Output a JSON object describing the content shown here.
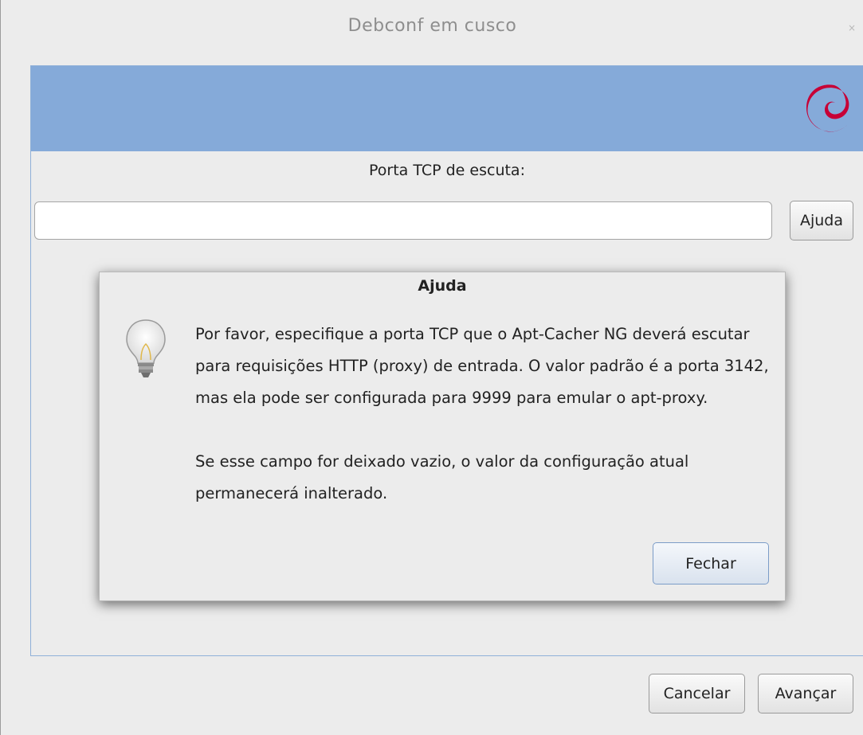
{
  "window": {
    "title": "Debconf em cusco",
    "close_glyph": "×"
  },
  "banner": {
    "logo_icon": "debian-swirl-logo",
    "color": "#85aad9",
    "logo_color": "#c70036"
  },
  "question": {
    "label": "Porta TCP de escuta:",
    "input_value": "",
    "help_label": "Ajuda"
  },
  "help_dialog": {
    "title": "Ajuda",
    "icon": "lightbulb-icon",
    "paragraph1": "Por favor, especifique a porta TCP que o Apt-Cacher NG deverá escutar para requisições HTTP (proxy) de entrada. O valor padrão é a porta 3142, mas ela pode ser configurada para 9999 para emular o apt-proxy.",
    "paragraph2": "Se esse campo for deixado vazio, o valor da configuração atual permanecerá inalterado.",
    "close_label": "Fechar"
  },
  "footer": {
    "cancel_label": "Cancelar",
    "next_label": "Avançar"
  }
}
